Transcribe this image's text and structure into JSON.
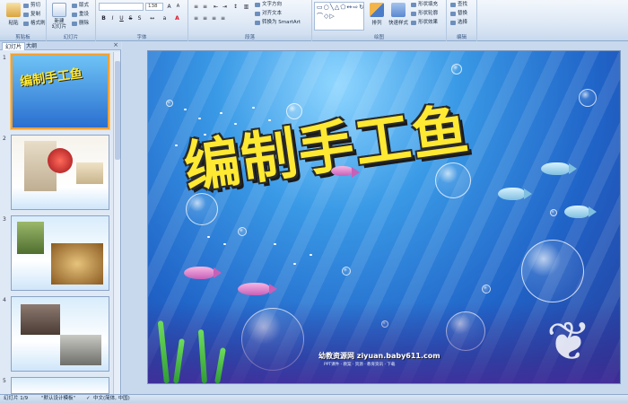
{
  "ribbon": {
    "groups": [
      "剪贴板",
      "幻灯片",
      "字体",
      "段落",
      "绘图",
      "编辑"
    ],
    "clipboard": {
      "paste": "粘贴",
      "cut": "剪切",
      "copy": "复制",
      "format_painter": "格式刷"
    },
    "slides": {
      "new_slide": "新建\n幻灯片",
      "layout": "版式",
      "reset": "重设",
      "delete": "删除"
    },
    "font": {
      "font_name": "",
      "font_size": "138"
    },
    "paragraph": {
      "text_direction": "文字方向",
      "align_text": "对齐文本",
      "smartart": "转换为 SmartArt"
    },
    "drawing": {
      "arrange": "排列",
      "quick_styles": "快速样式",
      "shape_fill": "形状填充",
      "shape_outline": "形状轮廓",
      "shape_effects": "形状效果"
    },
    "editing": {
      "find": "查找",
      "replace": "替换",
      "select": "选择"
    }
  },
  "panel": {
    "tabs": [
      "幻灯片",
      "大纲"
    ],
    "slide_numbers": [
      "1",
      "2",
      "3",
      "4",
      "5"
    ]
  },
  "slide": {
    "title": "编制手工鱼",
    "watermark": "幼教资源网 ziyuan.baby611.com",
    "watermark_sub": "PPT课件 · 教案 · 资源 · 教育资讯 · 下载"
  },
  "status": {
    "slide_info": "幻灯片 1/9",
    "theme": "\"默认设计模板\"",
    "language": "中文(简体, 中国)"
  },
  "colors": {
    "title_fill": "#ffe932",
    "ribbon_bg": "#dde8f5",
    "selected_thumb": "#f2a133"
  }
}
